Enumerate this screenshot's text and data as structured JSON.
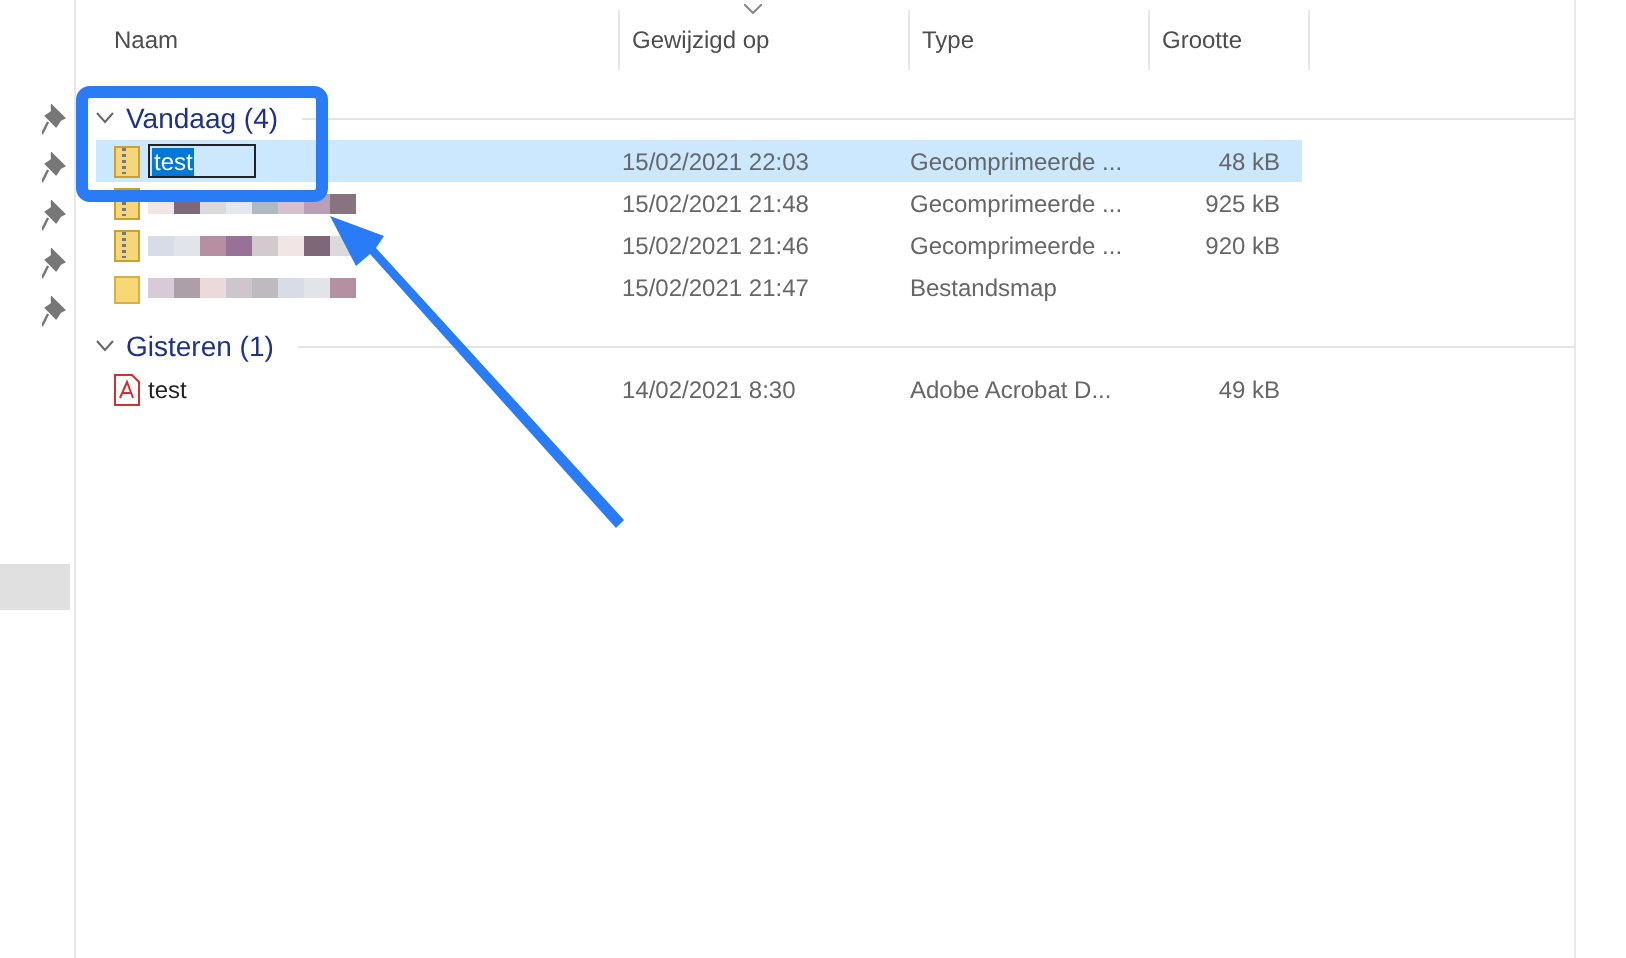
{
  "columns": [
    {
      "label": "Naam",
      "sorted": false
    },
    {
      "label": "Gewijzigd op",
      "sorted": true
    },
    {
      "label": "Type",
      "sorted": false
    },
    {
      "label": "Grootte",
      "sorted": false
    }
  ],
  "groups": [
    {
      "title": "Vandaag (4)",
      "expanded": true,
      "rows": [
        {
          "kind": "zip",
          "name": "test",
          "editing": true,
          "redacted": false,
          "selected": true,
          "date": "15/02/2021 22:03",
          "type": "Gecomprimeerde ...",
          "size": "48 kB"
        },
        {
          "kind": "zip",
          "redacted": true,
          "editing": false,
          "selected": false,
          "date": "15/02/2021 21:48",
          "type": "Gecomprimeerde ...",
          "size": "925 kB"
        },
        {
          "kind": "zip",
          "redacted": true,
          "editing": false,
          "selected": false,
          "date": "15/02/2021 21:46",
          "type": "Gecomprimeerde ...",
          "size": "920 kB"
        },
        {
          "kind": "folder",
          "redacted": true,
          "editing": false,
          "selected": false,
          "date": "15/02/2021 21:47",
          "type": "Bestandsmap"
        }
      ]
    },
    {
      "title": "Gisteren (1)",
      "expanded": true,
      "rows": [
        {
          "kind": "pdf",
          "name": "test",
          "editing": false,
          "redacted": false,
          "selected": false,
          "date": "14/02/2021 8:30",
          "type": "Adobe Acrobat D...",
          "size": "49 kB"
        }
      ]
    }
  ]
}
